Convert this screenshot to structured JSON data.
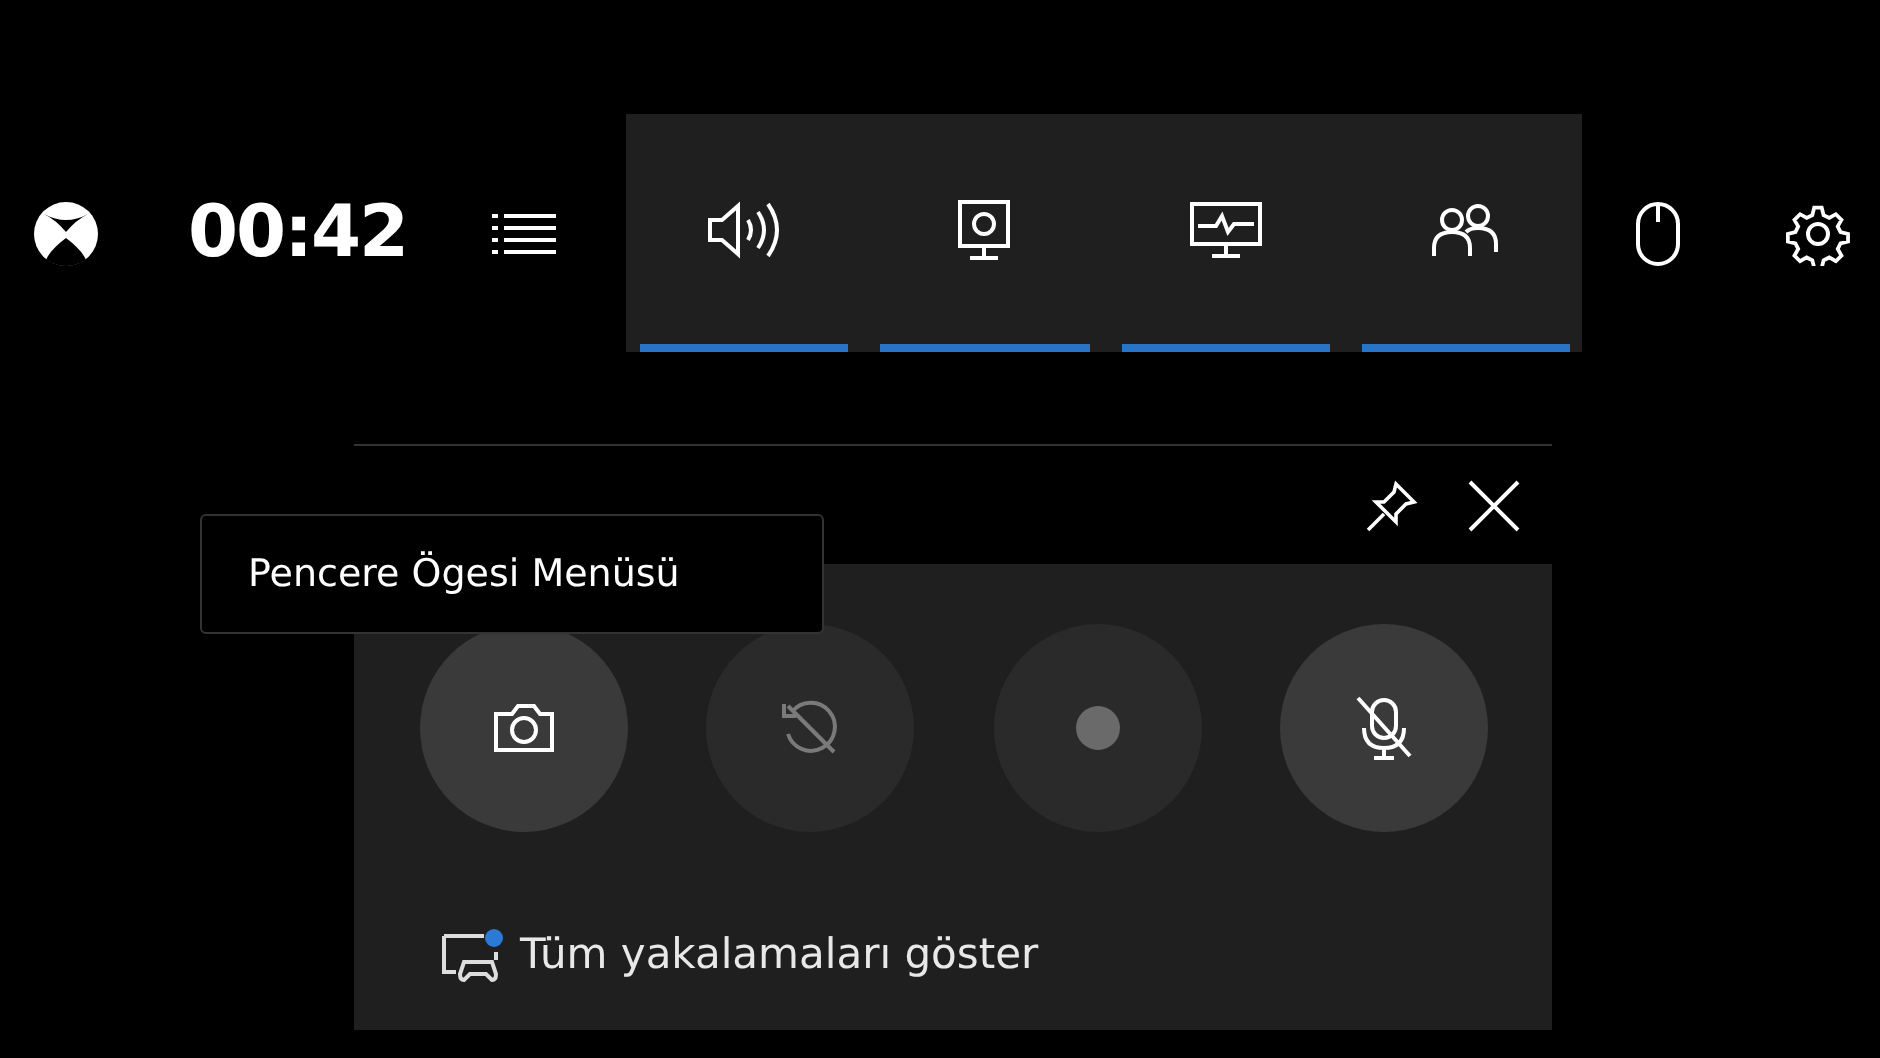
{
  "top_bar": {
    "timer": "00:42"
  },
  "widgets": [
    {
      "kind": "audio",
      "selected": true
    },
    {
      "kind": "capture",
      "selected": true
    },
    {
      "kind": "performance",
      "selected": true
    },
    {
      "kind": "social",
      "selected": true
    }
  ],
  "tooltip": {
    "text": "Pencere Ögesi Menüsü"
  },
  "capture_panel": {
    "buttons": [
      {
        "kind": "screenshot",
        "disabled": false
      },
      {
        "kind": "record-last",
        "disabled": true
      },
      {
        "kind": "record",
        "disabled": true
      },
      {
        "kind": "mic",
        "disabled": false
      }
    ],
    "link": {
      "text": "Tüm yakalamaları göster",
      "notification": true
    }
  }
}
